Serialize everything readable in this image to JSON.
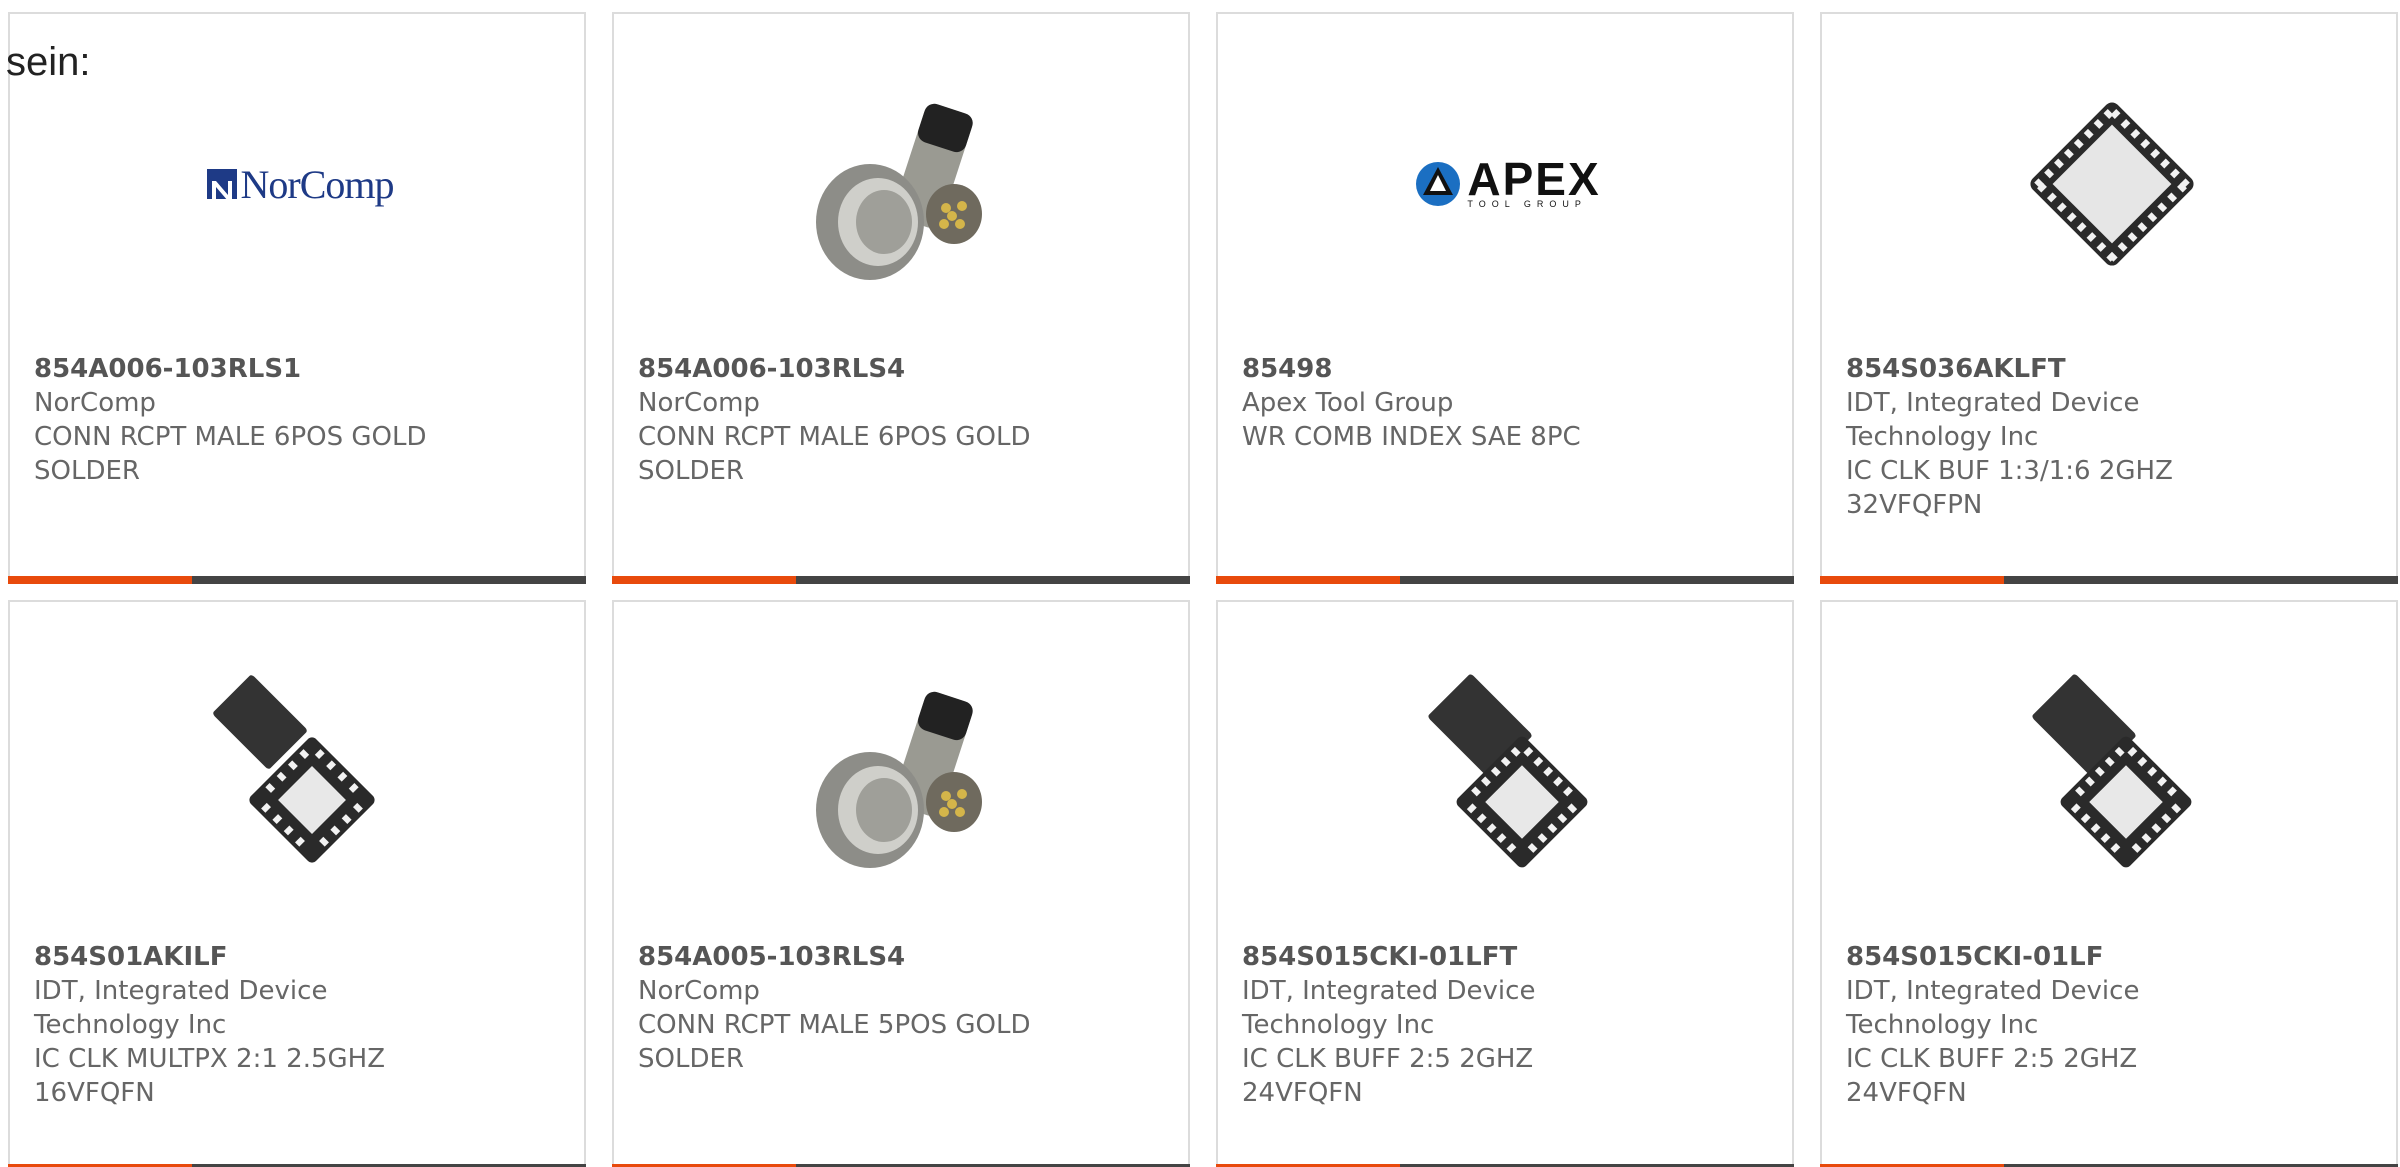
{
  "intro_text": "sein:",
  "colors": {
    "accent": "#e84a0c",
    "bar": "#444444",
    "border": "#dcdcdc",
    "text": "#666666"
  },
  "products": [
    {
      "part_number": "854A006-103RLS1",
      "manufacturer": "NorComp",
      "description_line1": "CONN RCPT MALE 6POS GOLD",
      "description_line2": "SOLDER",
      "image": "norcomp-logo",
      "logo_text": "NorComp"
    },
    {
      "part_number": "854A006-103RLS4",
      "manufacturer": "NorComp",
      "description_line1": "CONN RCPT MALE 6POS GOLD",
      "description_line2": "SOLDER",
      "image": "circular-connector-photo"
    },
    {
      "part_number": "85498",
      "manufacturer": "Apex Tool Group",
      "description_line1": "WR COMB INDEX SAE 8PC",
      "description_line2": "",
      "image": "apex-tool-group-logo",
      "logo_text": "APEX",
      "logo_subtext": "TOOL GROUP"
    },
    {
      "part_number": "854S036AKLFT",
      "manufacturer_line1": "IDT, Integrated Device",
      "manufacturer_line2": "Technology Inc",
      "description_line1": "IC CLK BUF 1:3/1:6 2GHZ",
      "description_line2": "32VFQFPN",
      "image": "qfn-chip-photo"
    },
    {
      "part_number": "854S01AKILF",
      "manufacturer_line1": "IDT, Integrated Device",
      "manufacturer_line2": "Technology Inc",
      "description_line1": "IC CLK MULTPX 2:1 2.5GHZ",
      "description_line2": "16VFQFN",
      "image": "qfn-chip-pair-photo"
    },
    {
      "part_number": "854A005-103RLS4",
      "manufacturer": "NorComp",
      "description_line1": "CONN RCPT MALE 5POS GOLD",
      "description_line2": "SOLDER",
      "image": "circular-connector-photo"
    },
    {
      "part_number": "854S015CKI-01LFT",
      "manufacturer_line1": "IDT, Integrated Device",
      "manufacturer_line2": "Technology Inc",
      "description_line1": "IC CLK BUFF 2:5 2GHZ 24VFQFN",
      "description_line2": "",
      "image": "qfn-chip-pair-photo"
    },
    {
      "part_number": "854S015CKI-01LF",
      "manufacturer_line1": "IDT, Integrated Device",
      "manufacturer_line2": "Technology Inc",
      "description_line1": "IC CLK BUFF 2:5 2GHZ 24VFQFN",
      "description_line2": "",
      "image": "qfn-chip-pair-photo"
    }
  ]
}
